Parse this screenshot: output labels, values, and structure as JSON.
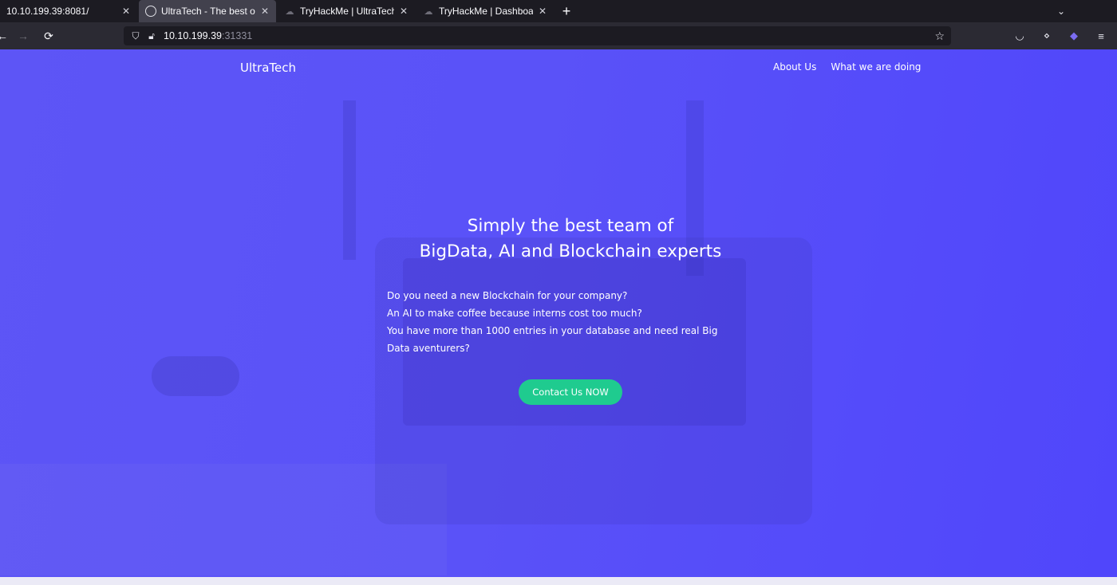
{
  "browser": {
    "tabs": [
      {
        "title": "10.10.199.39:8081/",
        "favicon": "none",
        "active": false
      },
      {
        "title": "UltraTech - The best of t",
        "favicon": "globe-icon",
        "active": true
      },
      {
        "title": "TryHackMe | UltraTech",
        "favicon": "cloud-icon",
        "active": false
      },
      {
        "title": "TryHackMe | Dashboard",
        "favicon": "cloud-icon",
        "active": false
      }
    ],
    "url_host": "10.10.199.39",
    "url_port": ":31331"
  },
  "site": {
    "brand": "UltraTech",
    "nav": [
      "About Us",
      "What we are doing"
    ],
    "hero": {
      "title_line1": "Simply the best team of",
      "title_line2": "BigData, AI and Blockchain experts",
      "lines": [
        "Do you need a new Blockchain for your company?",
        "An AI to make coffee because interns cost too much?",
        "You have more than 1000 entries in your database and need real Big Data aventurers?"
      ],
      "cta": "Contact Us NOW"
    }
  },
  "colors": {
    "hero_bg": "#5a52f8",
    "cta_bg": "#1fcb8f",
    "tabbar_bg": "#1c1b22",
    "toolbar_bg": "#2b2a33"
  }
}
